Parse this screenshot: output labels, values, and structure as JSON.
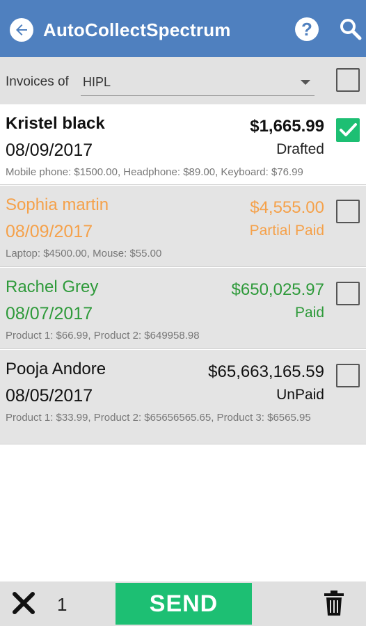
{
  "app": {
    "title": "AutoCollectSpectrum"
  },
  "filter": {
    "label": "Invoices of",
    "selected": "HIPL"
  },
  "invoices": [
    {
      "name": "Kristel black",
      "date": "08/09/2017",
      "amount": "$1,665.99",
      "status": "Drafted",
      "items": "Mobile phone: $1500.00, Headphone: $89.00, Keyboard: $76.99",
      "checked": true,
      "color": "#111111"
    },
    {
      "name": "Sophia martin",
      "date": "08/09/2017",
      "amount": "$4,555.00",
      "status": "Partial Paid",
      "items": "Laptop: $4500.00, Mouse: $55.00",
      "checked": false,
      "color": "#f5a14a"
    },
    {
      "name": "Rachel Grey",
      "date": "08/07/2017",
      "amount": "$650,025.97",
      "status": "Paid",
      "items": "Product 1: $66.99, Product 2: $649958.98",
      "checked": false,
      "color": "#2e9a3a"
    },
    {
      "name": "Pooja Andore",
      "date": "08/05/2017",
      "amount": "$65,663,165.59",
      "status": "UnPaid",
      "items": "Product 1: $33.99, Product 2: $65656565.65, Product 3: $6565.95",
      "checked": false,
      "color": "#111111"
    }
  ],
  "bottom": {
    "count": "1",
    "send_label": "SEND"
  },
  "colors": {
    "appbar": "#4f80bf",
    "accent_green": "#1dbf73"
  },
  "icons": {
    "back": "back-arrow-icon",
    "help": "help-icon",
    "search": "search-icon",
    "close": "close-icon",
    "trash": "trash-icon"
  }
}
